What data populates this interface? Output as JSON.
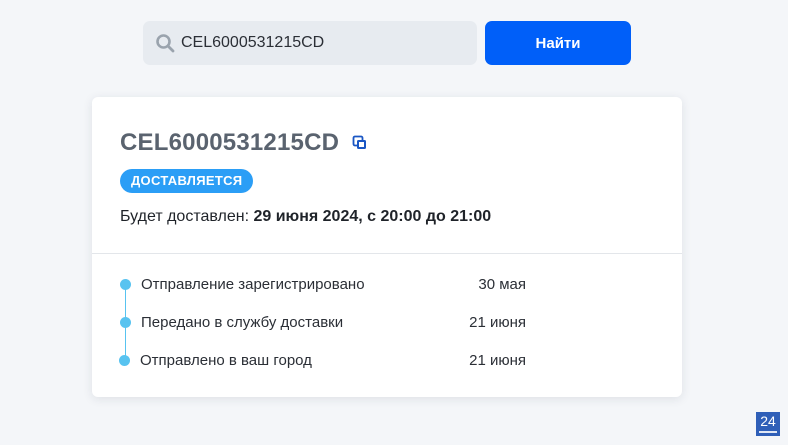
{
  "search": {
    "value": "CEL6000531215CD",
    "button_label": "Найти"
  },
  "card": {
    "tracking_number": "CEL6000531215CD",
    "status": "ДОСТАВЛЯЕТСЯ",
    "status_color": "#2b9ef6",
    "delivery_prefix": "Будет доставлен: ",
    "delivery_date": "29 июня 2024, с 20:00 до 21:00"
  },
  "events": [
    {
      "name": "Отправление зарегистрировано",
      "date": "30 мая"
    },
    {
      "name": "Передано в службу доставки",
      "date": "21 июня"
    },
    {
      "name": "Отправлено в ваш город",
      "date": "21 июня"
    }
  ],
  "corner_logo": {
    "text": "24"
  },
  "colors": {
    "accent": "#005ff9",
    "timeline": "#58c3f0",
    "background": "#f4f6f9"
  }
}
